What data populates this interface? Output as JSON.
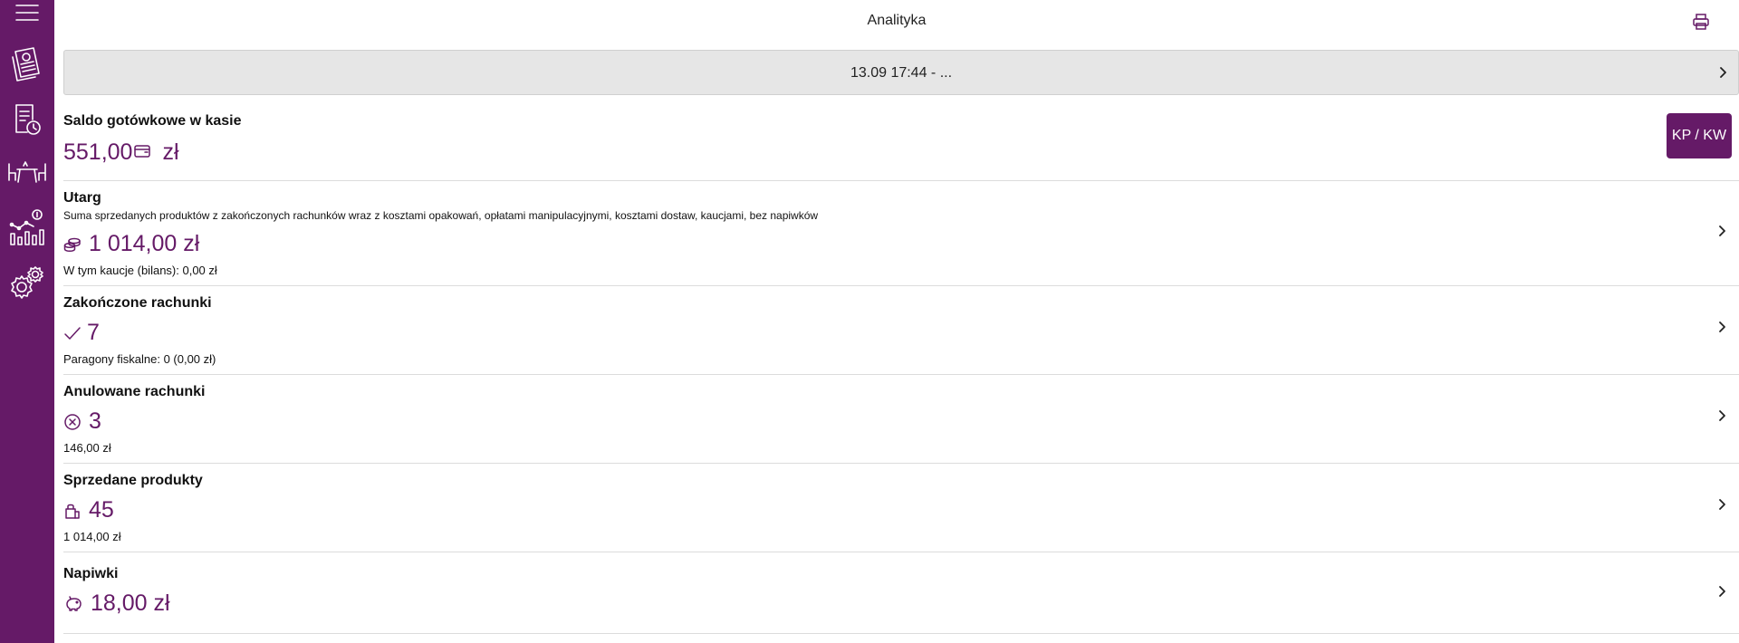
{
  "header": {
    "title": "Analityka",
    "print_icon": "printer-icon"
  },
  "sidebar": {
    "items": [
      {
        "icon": "menu-icon"
      },
      {
        "icon": "receipt-icon"
      },
      {
        "icon": "document-history-icon"
      },
      {
        "icon": "tables-icon"
      },
      {
        "icon": "analytics-icon"
      },
      {
        "icon": "gear-icon"
      }
    ]
  },
  "date_range": {
    "label": "13.09 17:44 - ..."
  },
  "cash_balance": {
    "title": "Saldo gotówkowe w kasie",
    "value": "551,00",
    "currency": "zł",
    "button": "KP / KW"
  },
  "revenue": {
    "title": "Utarg",
    "description": "Suma sprzedanych produktów z zakończonych rachunków wraz z kosztami opakowań, opłatami manipulacyjnymi, kosztami dostaw, kaucjami, bez napiwków",
    "value": "1 014,00 zł",
    "sub": "W tym kaucje (bilans): 0,00 zł"
  },
  "completed_bills": {
    "title": "Zakończone rachunki",
    "value": "7",
    "sub": "Paragony fiskalne: 0 (0,00 zł)"
  },
  "cancelled_bills": {
    "title": "Anulowane rachunki",
    "value": "3",
    "sub": "146,00 zł"
  },
  "sold_products": {
    "title": "Sprzedane produkty",
    "value": "45",
    "sub": "1 014,00 zł"
  },
  "tips": {
    "title": "Napiwki",
    "value": "18,00 zł"
  },
  "colors": {
    "accent": "#651a67",
    "date_bar_bg": "#e6e6e6"
  }
}
